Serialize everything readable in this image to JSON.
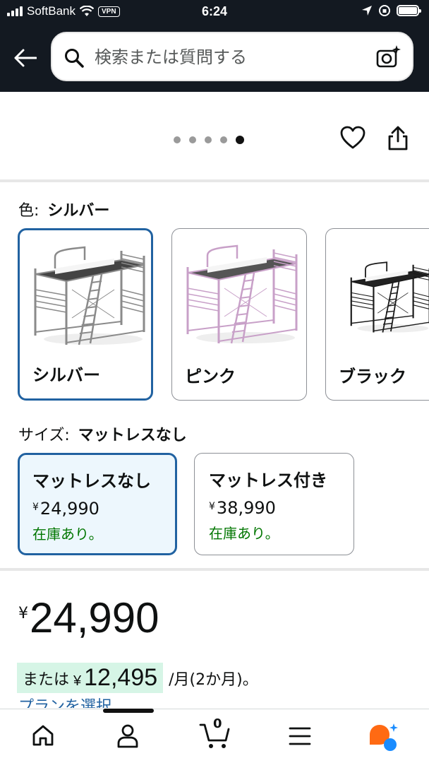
{
  "status_bar": {
    "carrier": "SoftBank",
    "vpn": "VPN",
    "time": "6:24"
  },
  "search": {
    "placeholder": "検索または質問する"
  },
  "carousel": {
    "dot_count": 5,
    "active_index": 4
  },
  "color": {
    "label": "色:",
    "selected": "シルバー",
    "options": [
      {
        "label": "シルバー",
        "frame_color": "#8a8a8a"
      },
      {
        "label": "ピンク",
        "frame_color": "#c8a0c8"
      },
      {
        "label": "ブラック",
        "frame_color": "#1a1a1a"
      }
    ]
  },
  "size": {
    "label": "サイズ:",
    "selected": "マットレスなし",
    "options": [
      {
        "name": "マットレスなし",
        "currency": "¥",
        "price": "24,990",
        "stock": "在庫あり。"
      },
      {
        "name": "マットレス付き",
        "currency": "¥",
        "price": "38,990",
        "stock": "在庫あり。"
      }
    ]
  },
  "price": {
    "currency": "¥",
    "amount": "24,990"
  },
  "installment": {
    "prefix": "または",
    "currency": "¥",
    "amount": "12,495",
    "suffix": "/月(2か月)。"
  },
  "plan_link": "プランを選択",
  "cart": {
    "count": "0"
  },
  "colors": {
    "header_bg": "#131921",
    "selected_border": "#2162a1",
    "in_stock": "#007600",
    "installment_bg": "#d6f5e6"
  }
}
